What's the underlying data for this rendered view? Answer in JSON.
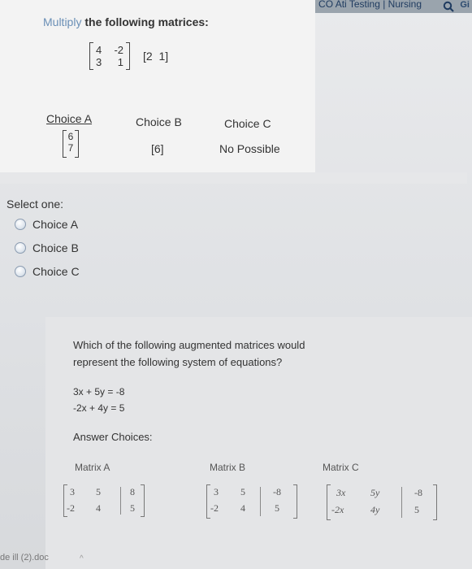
{
  "browser": {
    "tab_text": "CO Ati Testing | Nursing",
    "tab_suffix": "Gi"
  },
  "question1": {
    "title_faded": "Multiply",
    "title_rest": " the following matrices:",
    "matrix_left": [
      [
        "4",
        "-2"
      ],
      [
        "3",
        "1"
      ]
    ],
    "matrix_right": [
      "[2",
      "1]"
    ],
    "choices": [
      {
        "label": "Choice A",
        "value_top": "6",
        "value_bottom": "7"
      },
      {
        "label": "Choice B",
        "value": "[6]"
      },
      {
        "label": "Choice C",
        "value": "No Possible"
      }
    ]
  },
  "select": {
    "prompt": "Select one:",
    "options": [
      "Choice A",
      "Choice B",
      "Choice C"
    ]
  },
  "question2": {
    "line1": "Which of the following augmented matrices would",
    "line2": "represent the following system of equations?",
    "eq1": "3x + 5y = -8",
    "eq2": "-2x + 4y = 5",
    "answer_label": "Answer Choices:",
    "matrices": [
      {
        "label": "Matrix A",
        "rows": [
          [
            "3",
            "5",
            "8"
          ],
          [
            "-2",
            "4",
            "5"
          ]
        ]
      },
      {
        "label": "Matrix B",
        "rows": [
          [
            "3",
            "5",
            "-8"
          ],
          [
            "-2",
            "4",
            "5"
          ]
        ]
      },
      {
        "label": "Matrix C",
        "rows": [
          [
            "3x",
            "5y",
            "-8"
          ],
          [
            "-2x",
            "4y",
            "5"
          ]
        ]
      }
    ]
  },
  "footer": {
    "file": "de ill (2).doc",
    "chevron": "^"
  }
}
